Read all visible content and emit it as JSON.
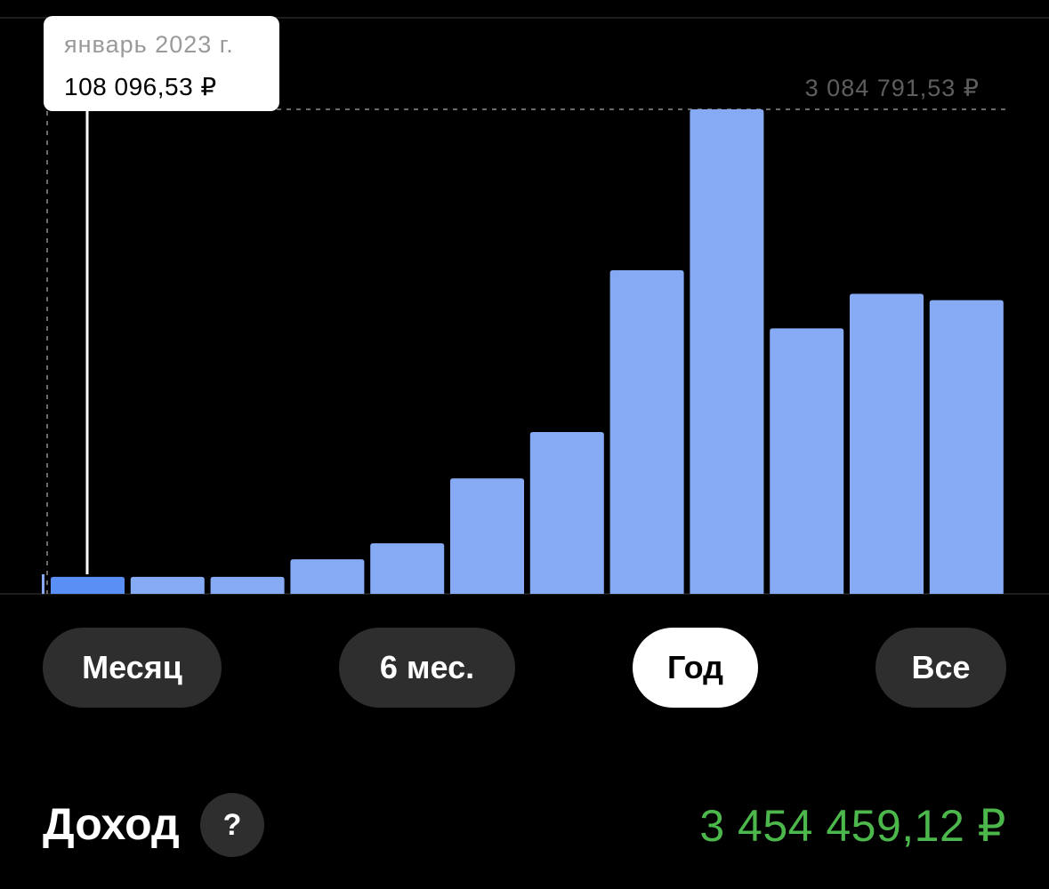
{
  "chart_data": {
    "type": "bar",
    "categories": [
      "январь 2023 г.",
      "",
      "",
      "",
      "",
      "",
      "",
      "",
      "",
      "",
      "",
      ""
    ],
    "values": [
      108096.53,
      108096.53,
      108096.53,
      220000,
      322000,
      735000,
      1030000,
      2060000,
      3084791.53,
      1690000,
      1910000,
      1870000
    ],
    "ylim": [
      0,
      3084791.53
    ],
    "max_label": "3 084 791,53 ₽",
    "selected_index": 0,
    "colors": {
      "bar": "#87aaf5",
      "selected_bar": "#5a8ff5",
      "gridline": "#3a3a3a",
      "dotted": "#6a6a6a"
    },
    "grid": false,
    "legend": "none"
  },
  "tooltip": {
    "date": "январь 2023 г.",
    "value": "108 096,53 ₽"
  },
  "periods": [
    {
      "label": "Месяц",
      "active": false
    },
    {
      "label": "6 мес.",
      "active": false
    },
    {
      "label": "Год",
      "active": true
    },
    {
      "label": "Все",
      "active": false
    }
  ],
  "income": {
    "label": "Доход",
    "help_icon": "question-icon",
    "help_glyph": "?",
    "value": "3 454 459,12 ₽",
    "value_color": "#4cb84c"
  }
}
